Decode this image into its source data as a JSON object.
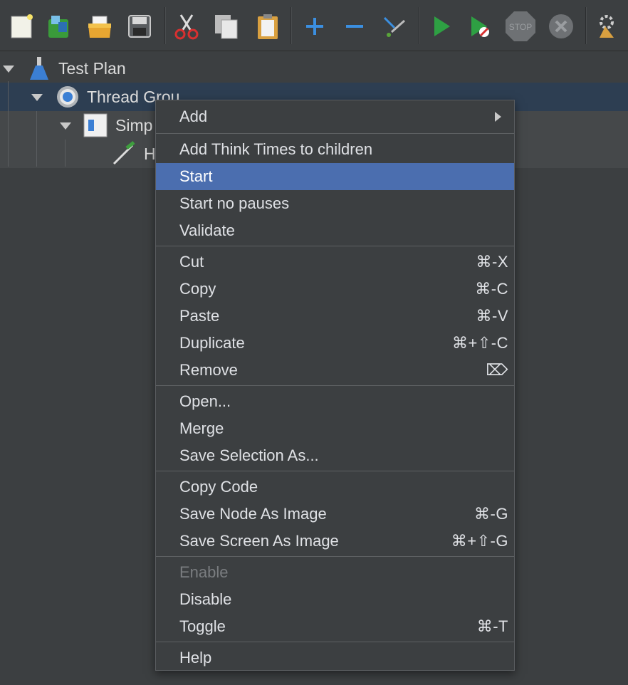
{
  "toolbar": {
    "icons": [
      "new-icon",
      "templates-icon",
      "open-icon",
      "save-icon",
      "cut-icon",
      "copy-icon",
      "paste-icon",
      "expand-icon",
      "collapse-icon",
      "toggle-icon",
      "start-icon",
      "start-no-pauses-icon",
      "stop-icon",
      "shutdown-icon",
      "clear-icon"
    ],
    "stop_text": "STOP"
  },
  "tree": {
    "test_plan": "Test Plan",
    "thread_group": "Thread Grou",
    "simple_controller": "Simp",
    "http_sampler": "H"
  },
  "menu": {
    "add": "Add",
    "add_think_times": "Add Think Times to children",
    "start": "Start",
    "start_no_pauses": "Start no pauses",
    "validate": "Validate",
    "cut": "Cut",
    "cut_sc": "⌘-X",
    "copy": "Copy",
    "copy_sc": "⌘-C",
    "paste": "Paste",
    "paste_sc": "⌘-V",
    "duplicate": "Duplicate",
    "duplicate_sc": "⌘+⇧-C",
    "remove": "Remove",
    "remove_sc": "⌦",
    "open": "Open...",
    "merge": "Merge",
    "save_selection": "Save Selection As...",
    "copy_code": "Copy Code",
    "save_node_image": "Save Node As Image",
    "save_node_image_sc": "⌘-G",
    "save_screen_image": "Save Screen As Image",
    "save_screen_image_sc": "⌘+⇧-G",
    "enable": "Enable",
    "disable": "Disable",
    "toggle": "Toggle",
    "toggle_sc": "⌘-T",
    "help": "Help"
  }
}
